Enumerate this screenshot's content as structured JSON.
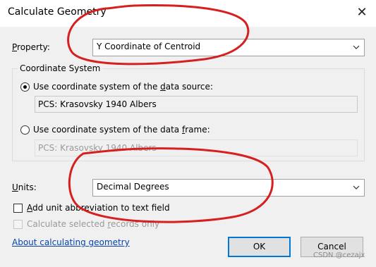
{
  "window": {
    "title": "Calculate Geometry",
    "close_glyph": "✕"
  },
  "property": {
    "label_pre": "P",
    "label_rest": "roperty:",
    "selected": "Y Coordinate of Centroid"
  },
  "coordinate_system": {
    "group_title": "Coordinate System",
    "option_source": {
      "label_pre": "Use coordinate system of the ",
      "label_u": "d",
      "label_post": "ata source:",
      "value": "PCS: Krasovsky 1940 Albers",
      "selected": true
    },
    "option_frame": {
      "label_pre": "Use coordinate system of the data ",
      "label_u": "f",
      "label_post": "rame:",
      "value": "PCS: Krasovsky 1940 Albers",
      "selected": false
    }
  },
  "units": {
    "label_pre": "U",
    "label_rest": "nits:",
    "selected": "Decimal Degrees"
  },
  "checkboxes": {
    "add_abbrev": {
      "label_pre": "",
      "label_u": "A",
      "label_post": "dd unit abbreviation to text field",
      "checked": false
    },
    "selected_only": {
      "label_pre": "Calculate selected ",
      "label_u": "r",
      "label_post": "ecords only",
      "checked": false,
      "enabled": false
    }
  },
  "help_link": "About calculating geometry",
  "buttons": {
    "ok": "OK",
    "cancel": "Cancel"
  },
  "watermark": "CSDN @cezajx",
  "colors": {
    "annotation": "#d61f1f",
    "link": "#0645ad",
    "default_button_border": "#0078d7"
  },
  "icons": {
    "dropdown": "chevron-down-icon",
    "close": "close-icon"
  }
}
